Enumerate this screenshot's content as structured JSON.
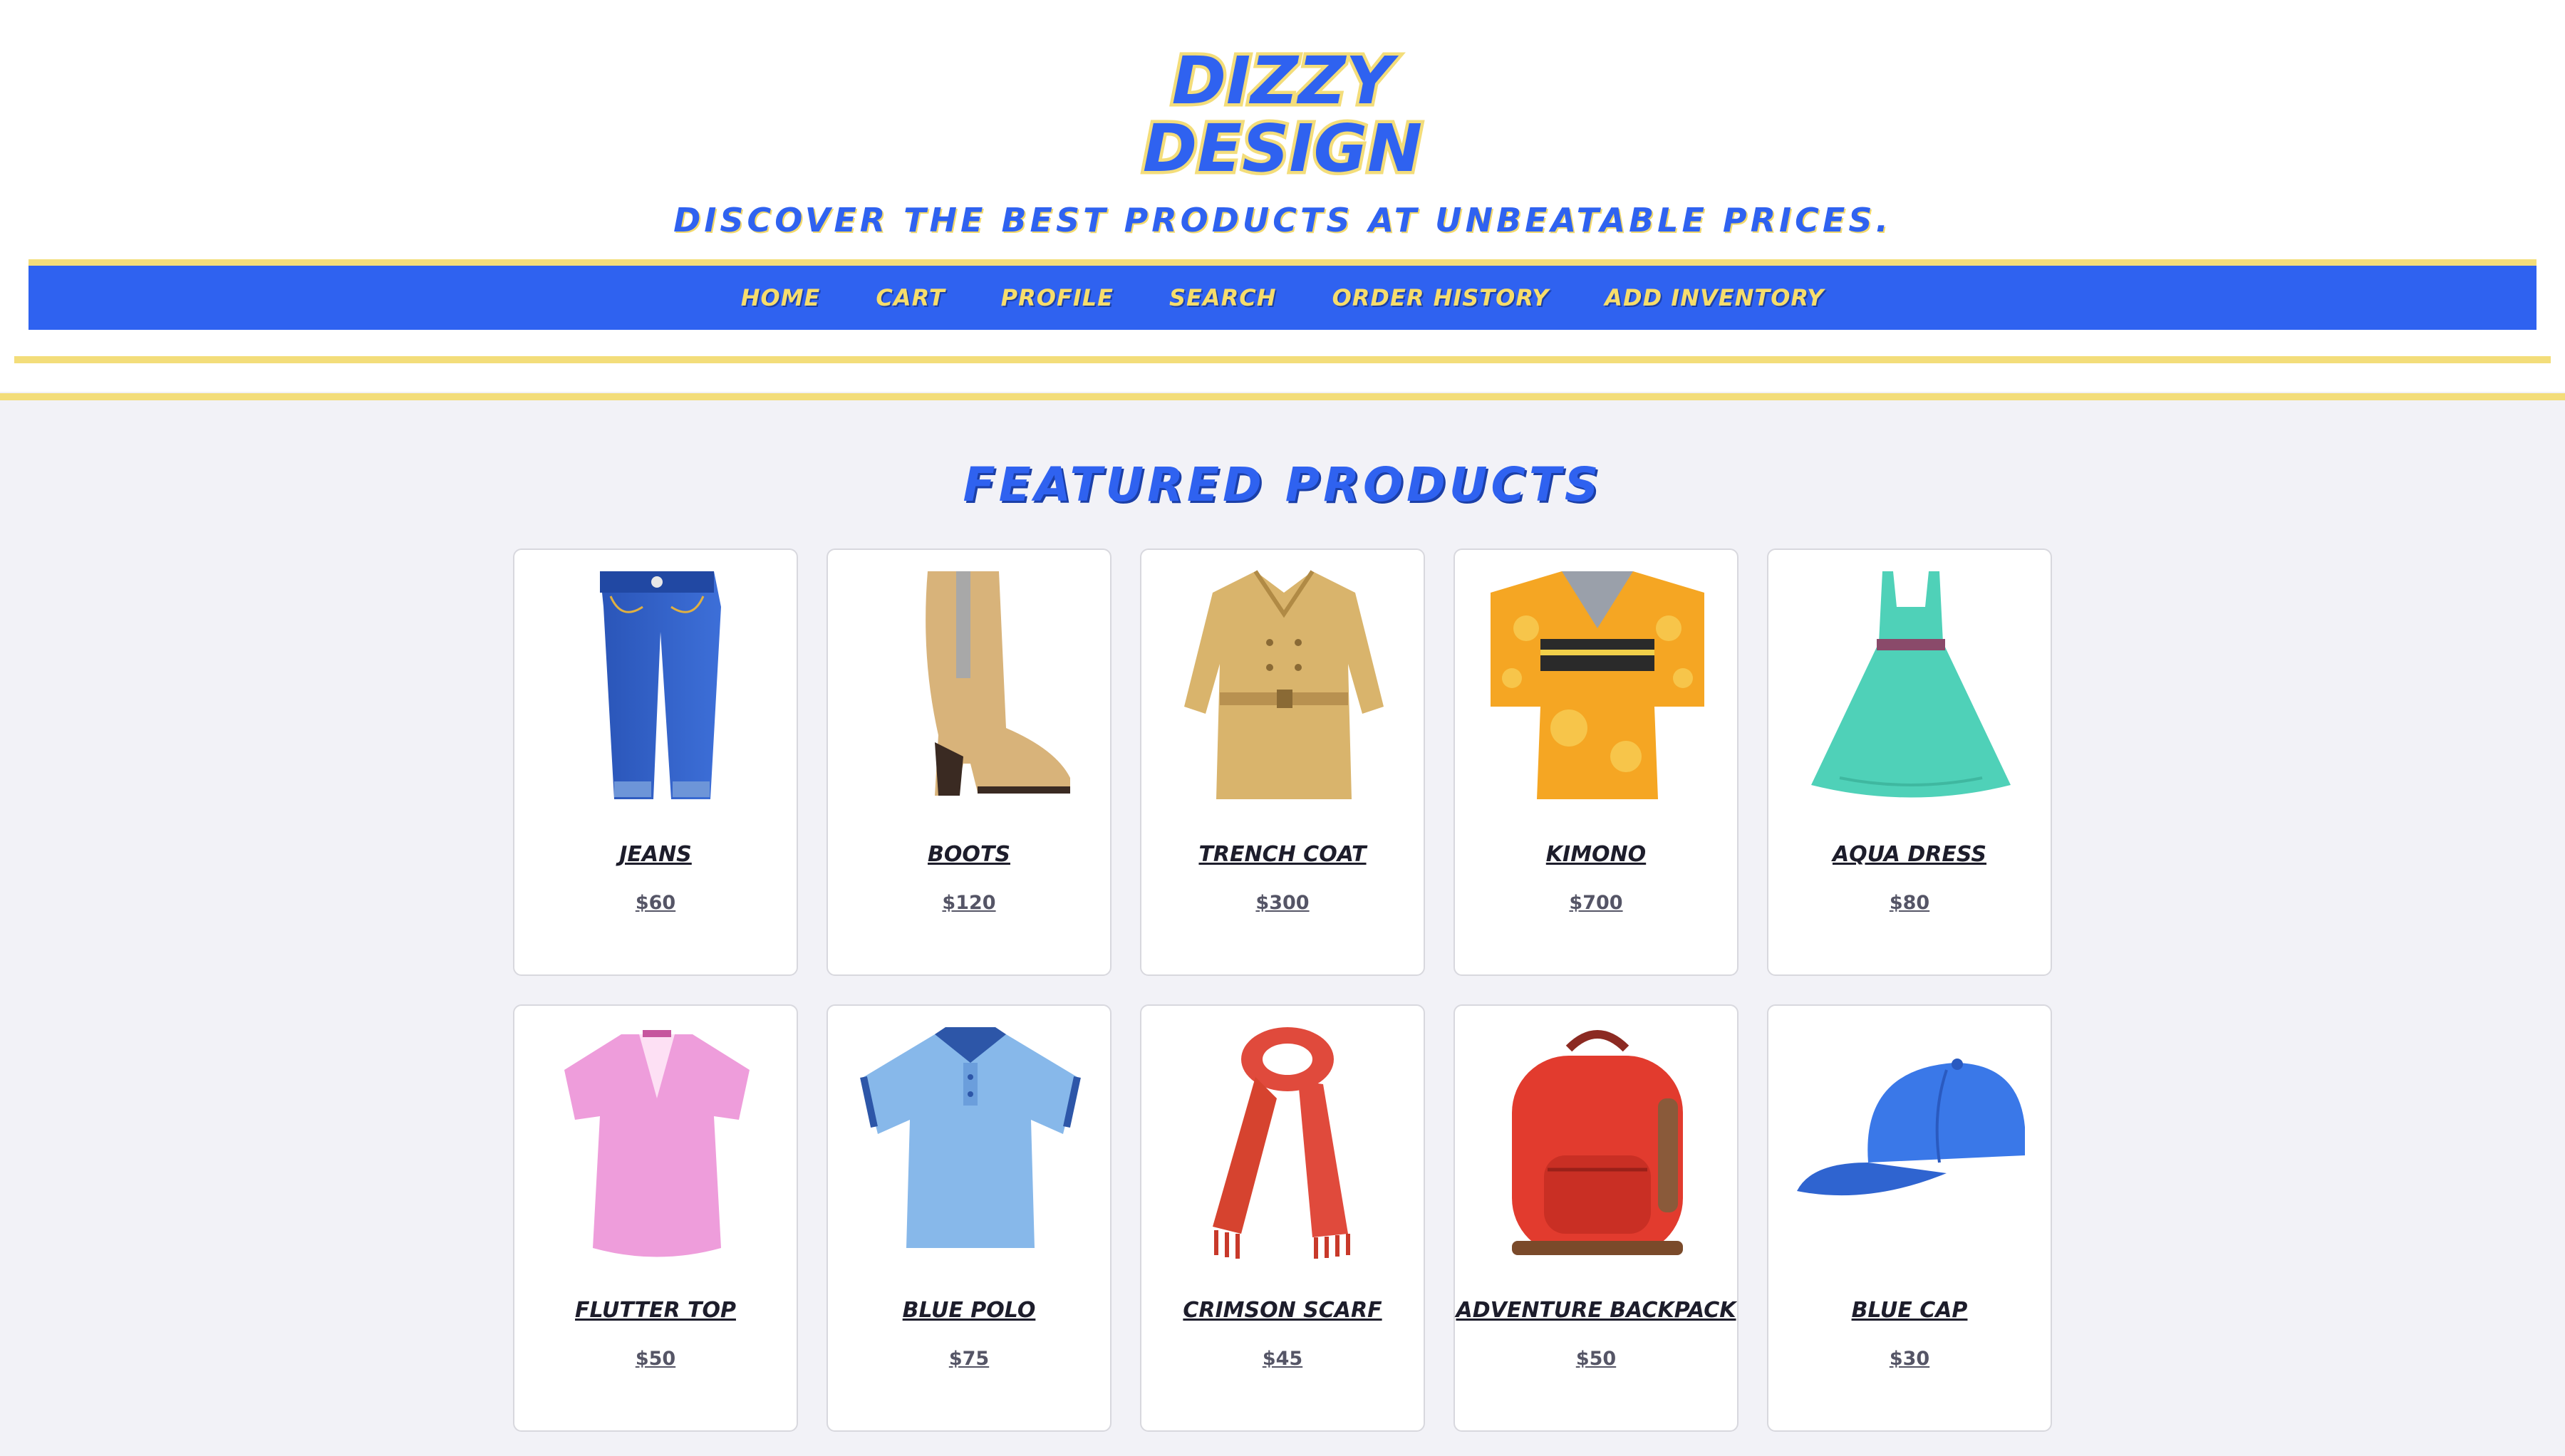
{
  "brand": {
    "line1": "DIZZY",
    "line2": "DESIGN"
  },
  "tagline": "Discover the best products at unbeatable prices.",
  "nav": {
    "items": [
      "Home",
      "Cart",
      "Profile",
      "Search",
      "Order History",
      "Add Inventory"
    ]
  },
  "section_title": "Featured Products",
  "products": [
    {
      "name": "Jeans",
      "price": "$60",
      "icon": "jeans-icon"
    },
    {
      "name": "Boots",
      "price": "$120",
      "icon": "boot-icon"
    },
    {
      "name": "Trench Coat",
      "price": "$300",
      "icon": "coat-icon"
    },
    {
      "name": "Kimono",
      "price": "$700",
      "icon": "kimono-icon"
    },
    {
      "name": "Aqua Dress",
      "price": "$80",
      "icon": "dress-icon"
    },
    {
      "name": "Flutter Top",
      "price": "$50",
      "icon": "blouse-icon"
    },
    {
      "name": "Blue Polo",
      "price": "$75",
      "icon": "polo-shirt-icon"
    },
    {
      "name": "Crimson Scarf",
      "price": "$45",
      "icon": "scarf-icon"
    },
    {
      "name": "Adventure Backpack",
      "price": "$50",
      "icon": "backpack-icon"
    },
    {
      "name": "Blue Cap",
      "price": "$30",
      "icon": "cap-icon"
    }
  ],
  "colors": {
    "brand_blue": "#2f62f0",
    "brand_yellow": "#f3dd7a",
    "page_bg": "#f2f2f7"
  }
}
